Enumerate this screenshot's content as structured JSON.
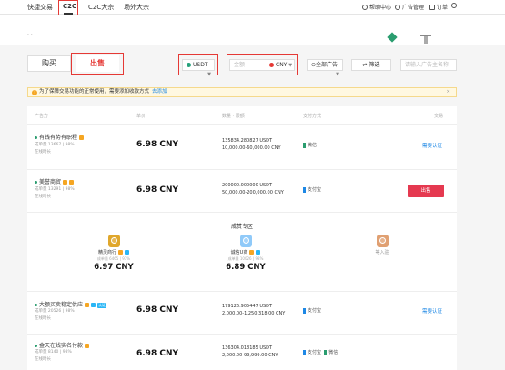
{
  "nav": {
    "items": [
      "快捷交易",
      "C2C",
      "C2C大宗",
      "场外大宗"
    ],
    "right": [
      "帮助中心",
      "广告管理",
      "订单"
    ]
  },
  "header": {
    "dots": "· · ·"
  },
  "tabs": {
    "buy": "购买",
    "sell": "出售"
  },
  "filters": {
    "coin": "USDT",
    "amount_placeholder": "金额",
    "currency": "CNY",
    "ad_type": "全部广告",
    "filter": "筛选",
    "search_placeholder": "请输入广告主名称"
  },
  "notice": {
    "text": "为了保障交易功能的正常使用，需要添加收款方式",
    "link": "去添加",
    "close": "×"
  },
  "table": {
    "headers": [
      "广告方",
      "单价",
      "数量 · 限额",
      "支付方式",
      "交易"
    ],
    "rows": [
      {
        "name": "有钱有势有职程",
        "stats": "成单量 13667 | 98%",
        "stats2": "在线时长",
        "price": "6.98 CNY",
        "qty": "135834.280827 USDT",
        "limit": "10,000.00-60,000.00 CNY",
        "pay1": "微信",
        "pay2": "",
        "action": "需要认证"
      },
      {
        "name": "美誉商贸",
        "stats": "成单量 13291 | 98%",
        "stats2": "在线时长",
        "price": "6.98 CNY",
        "qty": "200000.000000 USDT",
        "limit": "50,000.00-200,000.00 CNY",
        "pay1": "支付宝",
        "pay2": "",
        "action": "出售"
      },
      {
        "name": "大额买卖稳定供应",
        "stats": "成单量 20526 | 98%",
        "stats2": "在线时长",
        "price": "6.98 CNY",
        "qty": "179126.905447 USDT",
        "limit": "2,000.00-1,250,318.00 CNY",
        "pay1": "支付宝",
        "pay2": "",
        "action": "需要认证",
        "badge": "认证"
      },
      {
        "name": "金天在线实名付款",
        "stats": "成单量 8140 | 98%",
        "stats2": "在线时长",
        "price": "6.98 CNY",
        "qty": "136304.018185 USDT",
        "limit": "2,000.00-99,999.00 CNY",
        "pay1": "支付宝",
        "pay2": "微信",
        "action": ""
      }
    ]
  },
  "featured": {
    "title": "成赞专区",
    "cards": [
      {
        "name": "精灵商行",
        "stats": "成单量 6465 | 97%",
        "price": "6.97 CNY"
      },
      {
        "name": "诚信U商",
        "stats": "成单量 10026 | 98%",
        "price": "6.89 CNY"
      },
      {
        "name": "等入驻",
        "stats": "",
        "price": ""
      }
    ]
  },
  "colors": {
    "accent": "#e53935",
    "link": "#1e88e5",
    "green": "#2a9d6f",
    "sell_button": "#e53950"
  }
}
